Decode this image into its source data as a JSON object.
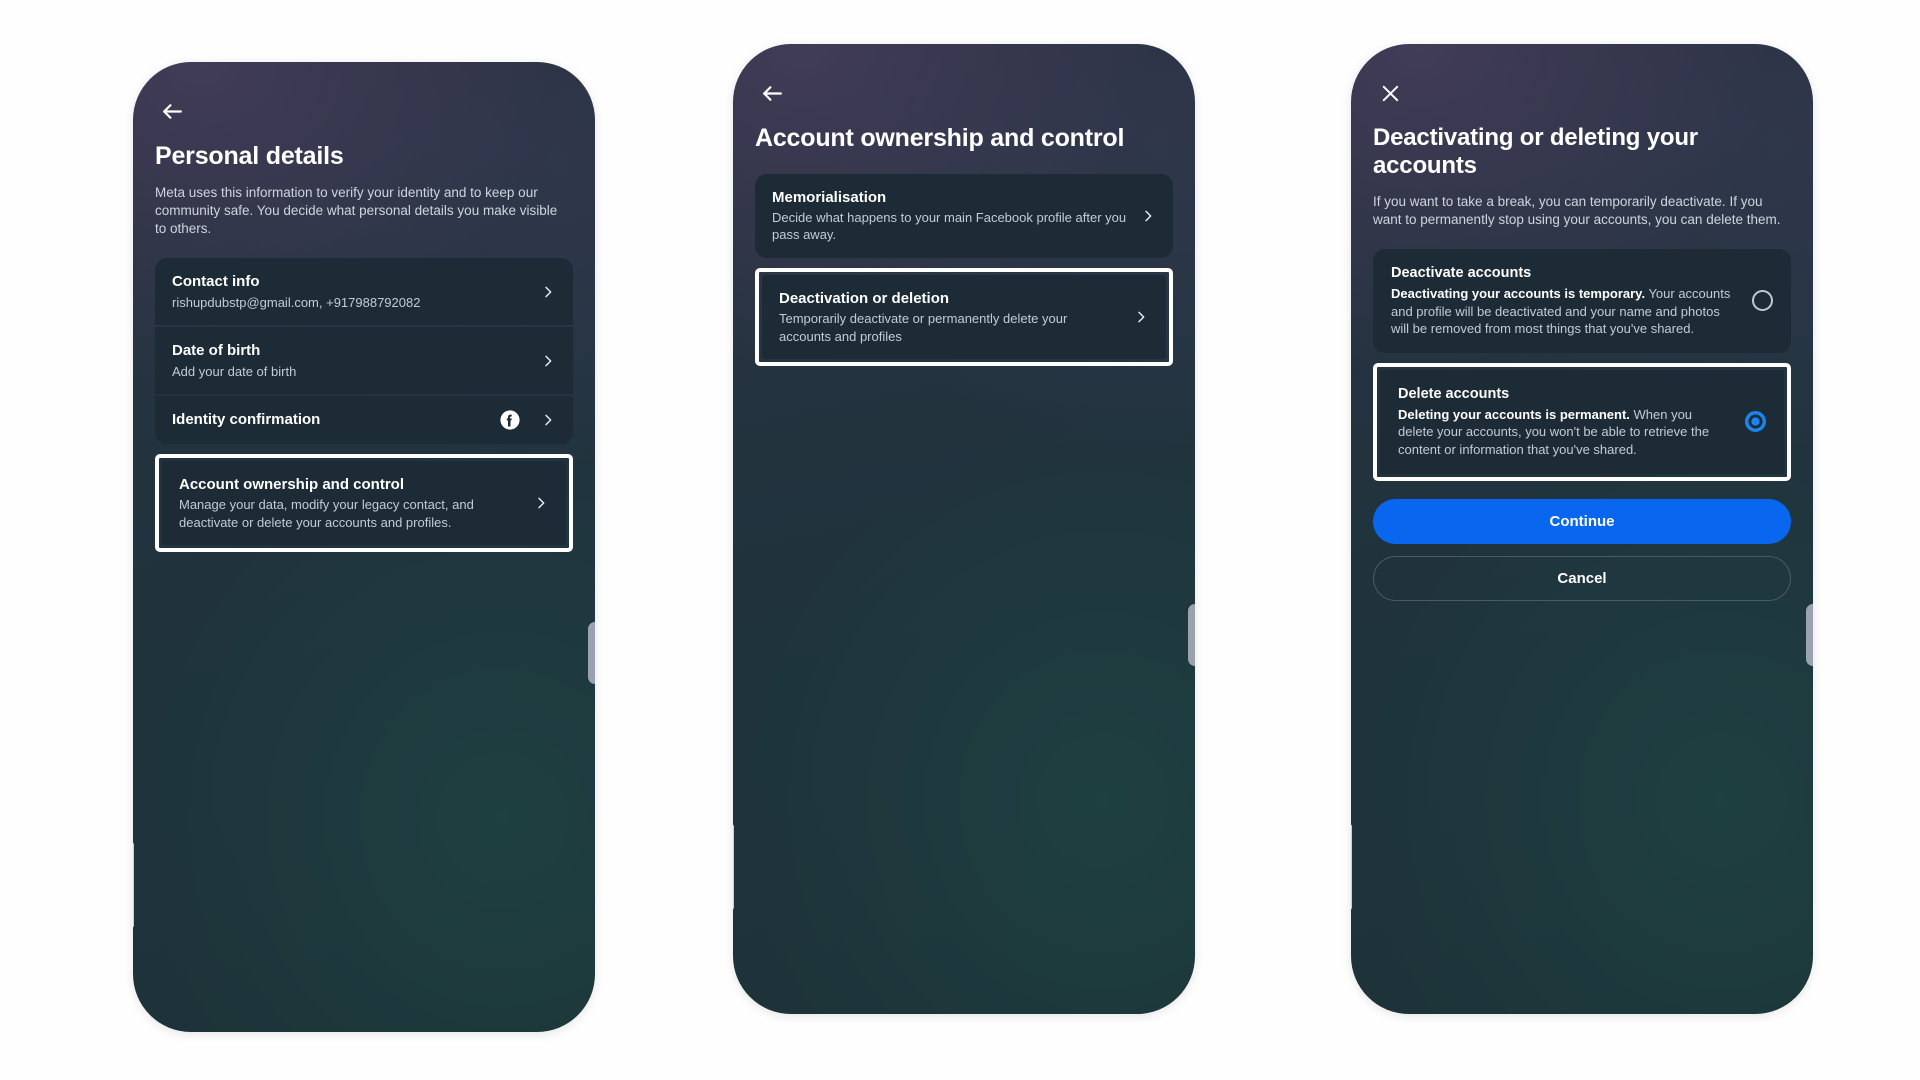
{
  "screens": [
    {
      "id": "personal-details",
      "nav_icon": "back-arrow-icon",
      "title": "Personal details",
      "description": "Meta uses this information to verify your identity and to keep our community safe. You decide what personal details you make visible to others.",
      "items": [
        {
          "title": "Contact info",
          "subtitle": "rishupdubstp@gmail.com, +917988792082",
          "chevron": "chevron-right-icon",
          "badge": null,
          "highlighted": false
        },
        {
          "title": "Date of birth",
          "subtitle": "Add your date of birth",
          "chevron": "chevron-right-icon",
          "badge": null,
          "highlighted": false
        },
        {
          "title": "Identity confirmation",
          "subtitle": "",
          "chevron": "chevron-right-icon",
          "badge": "facebook-icon",
          "highlighted": false
        },
        {
          "title": "Account ownership and control",
          "subtitle": "Manage your data, modify your legacy contact, and deactivate or delete your accounts and profiles.",
          "chevron": "chevron-right-icon",
          "badge": null,
          "highlighted": true
        }
      ]
    },
    {
      "id": "account-ownership-and-control",
      "nav_icon": "back-arrow-icon",
      "title": "Account ownership and control",
      "description": "",
      "items": [
        {
          "title": "Memorialisation",
          "subtitle": "Decide what happens to your main Facebook profile after you pass away.",
          "chevron": "chevron-right-icon",
          "badge": null,
          "highlighted": false
        },
        {
          "title": "Deactivation or deletion",
          "subtitle": "Temporarily deactivate or permanently delete your accounts and profiles",
          "chevron": "chevron-right-icon",
          "badge": null,
          "highlighted": true
        }
      ]
    },
    {
      "id": "deactivating-or-deleting",
      "nav_icon": "close-icon",
      "title": "Deactivating or deleting your accounts",
      "description": "If you want to take a break, you can temporarily deactivate. If you want to permanently stop using your accounts, you can delete them.",
      "options": [
        {
          "title": "Deactivate accounts",
          "lead": "Deactivating your accounts is temporary.",
          "rest": " Your accounts and profile will be deactivated and your name and photos will be removed from most things that you've shared.",
          "selected": false,
          "highlighted": false
        },
        {
          "title": "Delete accounts",
          "lead": "Deleting your accounts is permanent.",
          "rest": " When you delete your accounts, you won't be able to retrieve the content or information that you've shared.",
          "selected": true,
          "highlighted": true
        }
      ],
      "buttons": [
        {
          "label": "Continue",
          "style": "primary"
        },
        {
          "label": "Cancel",
          "style": "secondary"
        }
      ]
    }
  ],
  "colors": {
    "accent_blue": "#0866ef",
    "radio_blue": "#1b84ee",
    "card_bg": "#1c2b35",
    "highlight_ring": "#ffffff",
    "page_bg": "#ffffff"
  }
}
